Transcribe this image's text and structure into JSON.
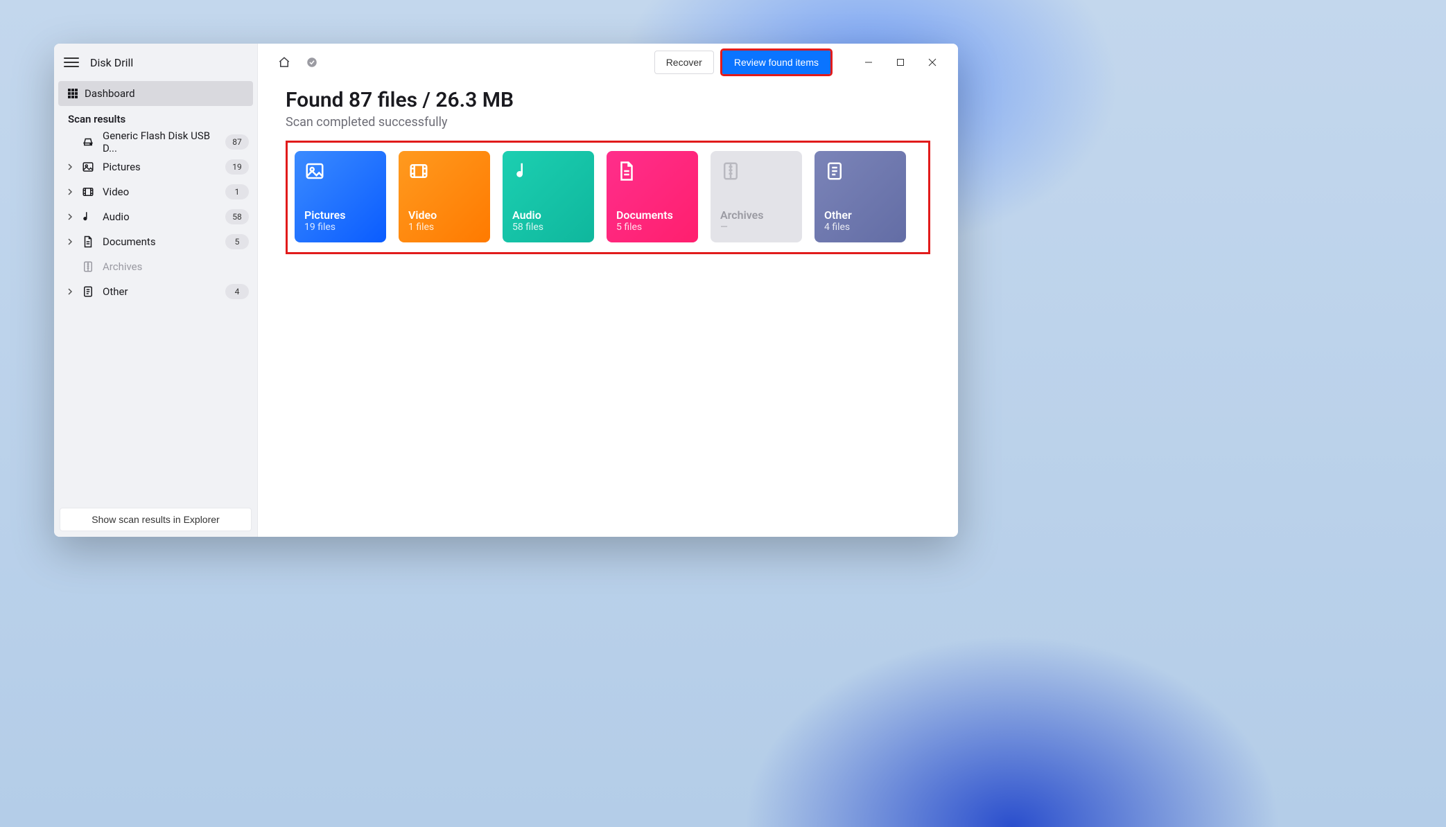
{
  "app_title": "Disk Drill",
  "sidebar": {
    "dashboard_label": "Dashboard",
    "section_label": "Scan results",
    "device": {
      "label": "Generic Flash Disk USB D...",
      "count": "87"
    },
    "items": [
      {
        "key": "pictures",
        "label": "Pictures",
        "count": "19"
      },
      {
        "key": "video",
        "label": "Video",
        "count": "1"
      },
      {
        "key": "audio",
        "label": "Audio",
        "count": "58"
      },
      {
        "key": "documents",
        "label": "Documents",
        "count": "5"
      },
      {
        "key": "archives",
        "label": "Archives",
        "count": null
      },
      {
        "key": "other",
        "label": "Other",
        "count": "4"
      }
    ],
    "footer_button": "Show scan results in Explorer"
  },
  "header": {
    "recover_label": "Recover",
    "review_label": "Review found items"
  },
  "main": {
    "title": "Found 87 files / 26.3 MB",
    "subtitle": "Scan completed successfully"
  },
  "tiles": {
    "pictures": {
      "label": "Pictures",
      "sub": "19 files"
    },
    "video": {
      "label": "Video",
      "sub": "1 files"
    },
    "audio": {
      "label": "Audio",
      "sub": "58 files"
    },
    "documents": {
      "label": "Documents",
      "sub": "5 files"
    },
    "archives": {
      "label": "Archives",
      "sub": "—"
    },
    "other": {
      "label": "Other",
      "sub": "4 files"
    }
  }
}
